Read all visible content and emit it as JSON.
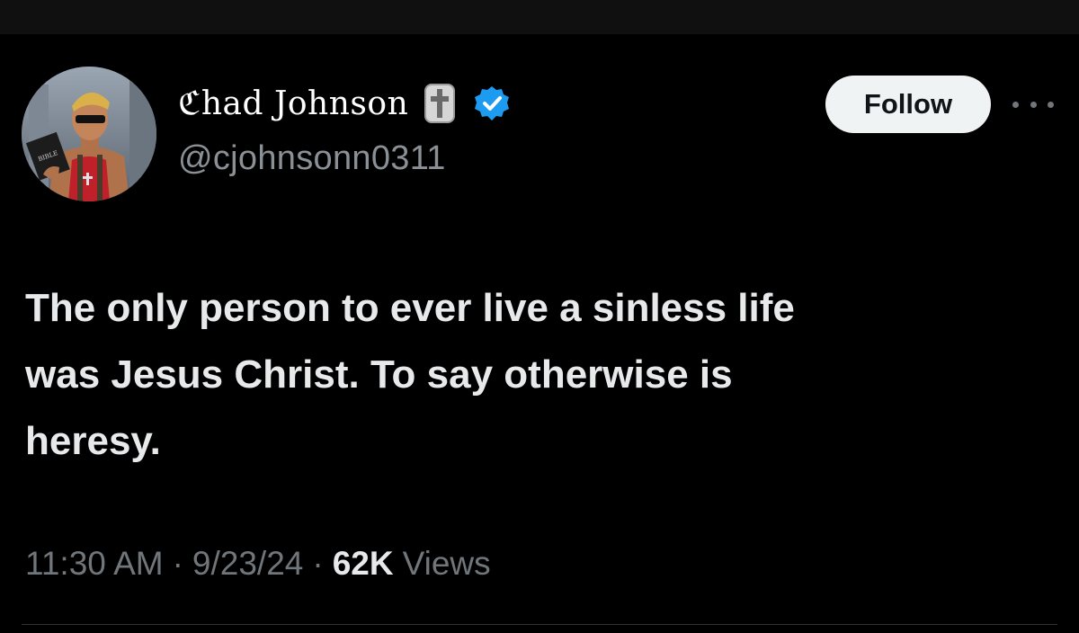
{
  "author": {
    "display_name": "ℭhad Johnson",
    "handle": "@cjohnsonn0311",
    "verified": true,
    "avatar_book_label": "BIBLE"
  },
  "actions": {
    "follow_label": "Follow"
  },
  "tweet": {
    "text": "The only person to ever live a sinless life\nwas Jesus Christ. To say otherwise is\nheresy."
  },
  "meta": {
    "time": "11:30 AM",
    "separator": "·",
    "date": "9/23/24",
    "views_count": "62K",
    "views_label": "Views"
  },
  "colors": {
    "background": "#000000",
    "text": "#e7e9ea",
    "secondary_text": "#71767b",
    "verified_badge": "#1d9bf0",
    "follow_button_bg": "#eff3f4"
  },
  "icons": [
    "cross-emoji-icon",
    "verified-badge-icon",
    "more-options-icon"
  ]
}
